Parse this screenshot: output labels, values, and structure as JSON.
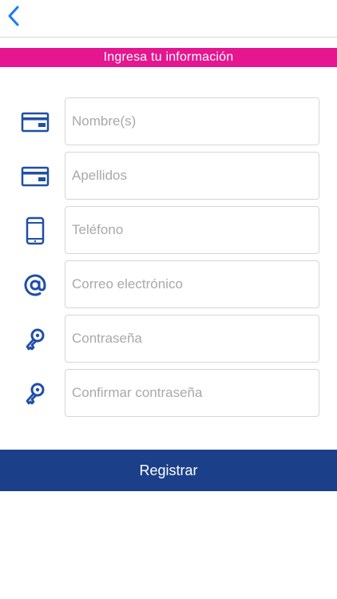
{
  "header": {
    "back_icon": "chevron-left-icon"
  },
  "banner": {
    "title": "Ingresa tu información"
  },
  "form": {
    "fields": [
      {
        "icon": "id-card-icon",
        "placeholder": "Nombre(s)",
        "value": ""
      },
      {
        "icon": "id-card-icon",
        "placeholder": "Apellidos",
        "value": ""
      },
      {
        "icon": "smartphone-icon",
        "placeholder": "Teléfono",
        "value": ""
      },
      {
        "icon": "at-sign-icon",
        "placeholder": "Correo electrónico",
        "value": ""
      },
      {
        "icon": "key-icon",
        "placeholder": "Contraseña",
        "value": ""
      },
      {
        "icon": "key-icon",
        "placeholder": "Confirmar contraseña",
        "value": ""
      }
    ]
  },
  "actions": {
    "register_label": "Registrar"
  },
  "colors": {
    "accent_pink": "#e5168f",
    "primary_blue": "#1b4089",
    "icon_blue": "#1f4fa6",
    "back_blue": "#1a7cf5"
  }
}
